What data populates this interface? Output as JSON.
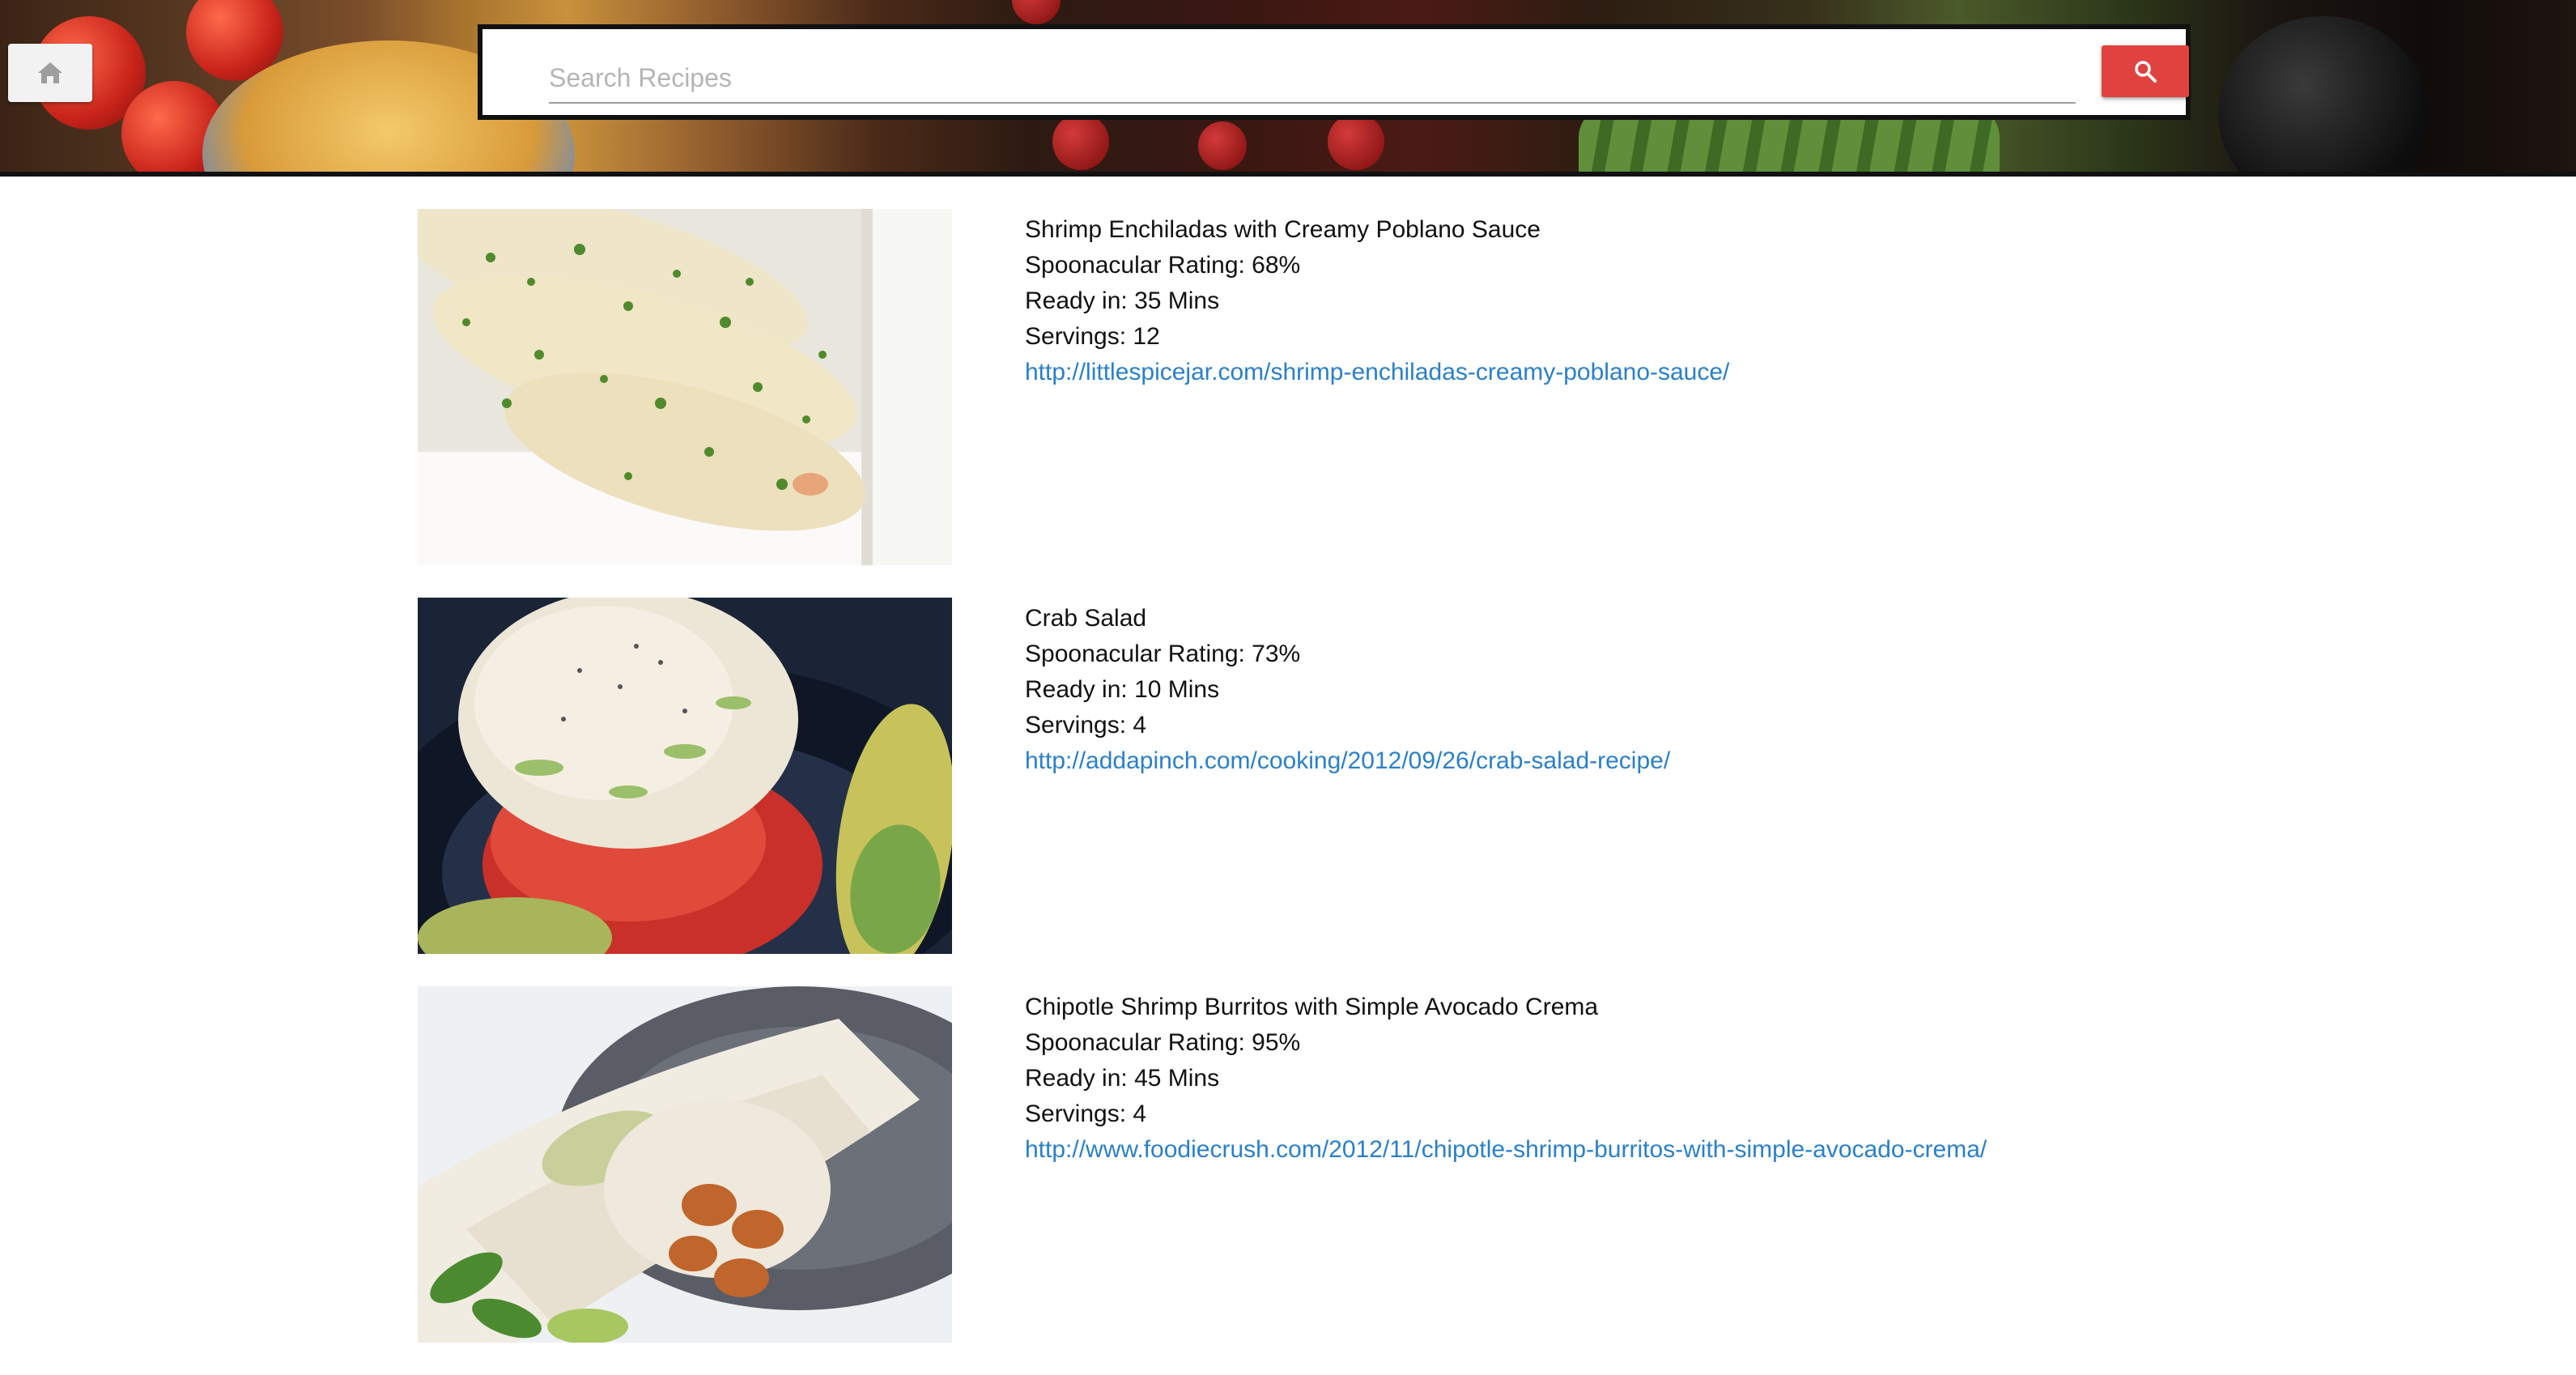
{
  "header": {
    "home_icon": "home-icon",
    "search": {
      "placeholder": "Search Recipes",
      "value": "",
      "button_icon": "search-icon",
      "button_color": "#e0433f"
    }
  },
  "recipes": [
    {
      "title": "Shrimp Enchiladas with Creamy Poblano Sauce",
      "rating": "Spoonacular Rating: 68%",
      "ready": "Ready in: 35 Mins",
      "servings": "Servings: 12",
      "url": "http://littlespicejar.com/shrimp-enchiladas-creamy-poblano-sauce/"
    },
    {
      "title": "Crab Salad",
      "rating": "Spoonacular Rating: 73%",
      "ready": "Ready in: 10 Mins",
      "servings": "Servings: 4",
      "url": "http://addapinch.com/cooking/2012/09/26/crab-salad-recipe/"
    },
    {
      "title": "Chipotle Shrimp Burritos with Simple Avocado Crema",
      "rating": "Spoonacular Rating: 95%",
      "ready": "Ready in: 45 Mins",
      "servings": "Servings: 4",
      "url": "http://www.foodiecrush.com/2012/11/chipotle-shrimp-burritos-with-simple-avocado-crema/"
    }
  ],
  "colors": {
    "link": "#2a80c9",
    "accent": "#e0433f"
  }
}
